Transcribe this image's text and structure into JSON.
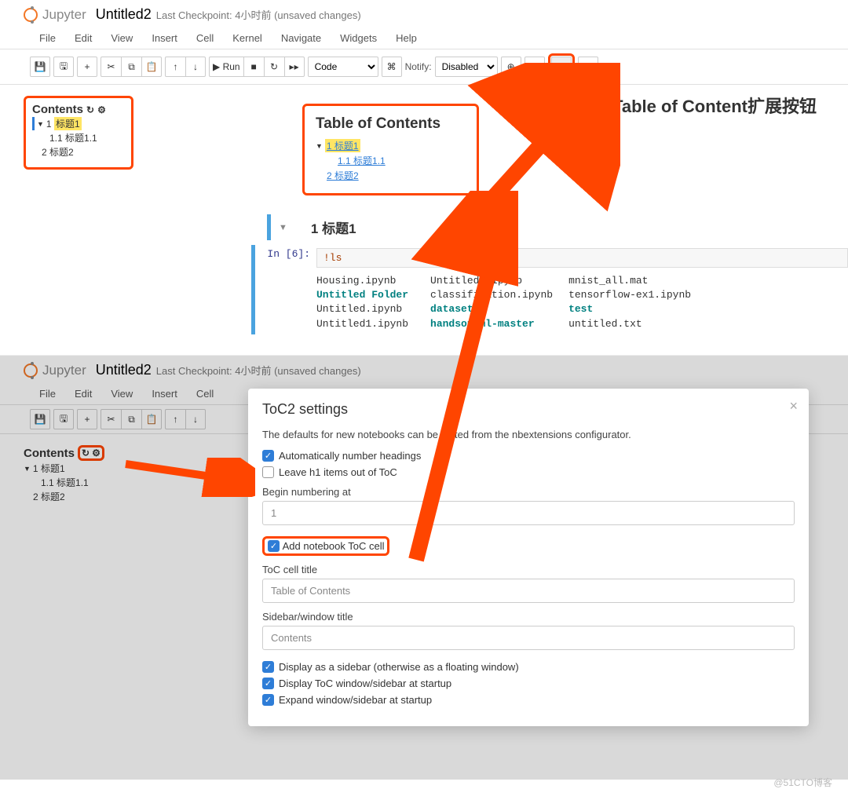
{
  "brand": "Jupyter",
  "title": "Untitled2",
  "checkpoint": "Last Checkpoint: 4小时前  (unsaved changes)",
  "menu": [
    "File",
    "Edit",
    "View",
    "Insert",
    "Cell",
    "Kernel",
    "Navigate",
    "Widgets",
    "Help"
  ],
  "toolbar": {
    "run": "▶ Run",
    "celltype": "Code",
    "notify_label": "Notify:",
    "notify_value": "Disabled"
  },
  "ext_label": "Table of Content扩展按钮",
  "sidebar": {
    "title": "Contents",
    "items": [
      {
        "n": "1",
        "label": "标题1",
        "level": 1,
        "active": true
      },
      {
        "n": "1.1",
        "label": "标题1.1",
        "level": 2
      },
      {
        "n": "2",
        "label": "标题2",
        "level": 1
      }
    ]
  },
  "toc_cell": {
    "title": "Table of Contents",
    "items": [
      {
        "label": "1  标题1",
        "level": 1,
        "active": true
      },
      {
        "label": "1.1  标题1.1",
        "level": 2
      },
      {
        "label": "2  标题2",
        "level": 1
      }
    ]
  },
  "heading": "1  标题1",
  "code": {
    "prompt": "In [6]:",
    "input": "!ls",
    "output_cols": [
      "Housing.ipynb\nUntitled Folder\nUntitled.ipynb\nUntitled1.ipynb",
      "Untitled2.ipynb\nclassification.ipynb\ndatasets\nhandson-ml-master",
      "mnist_all.mat\ntensorflow-ex1.ipynb\ntest\nuntitled.txt"
    ],
    "output_bold_rows": {
      "1": [
        1
      ],
      "2": [
        2,
        3
      ],
      "3": [
        2
      ]
    }
  },
  "modal": {
    "title": "ToC2 settings",
    "desc": "The defaults for new notebooks can be edited from the nbextensions configurator.",
    "opt_auto_number": "Automatically number headings",
    "opt_leave_h1": "Leave h1 items out of ToC",
    "label_begin": "Begin numbering at",
    "value_begin": "1",
    "opt_add_toc_cell": "Add notebook ToC cell",
    "label_toc_title": "ToC cell title",
    "value_toc_title": "Table of Contents",
    "label_sidebar_title": "Sidebar/window title",
    "value_sidebar_title": "Contents",
    "opt_display_sidebar": "Display as a sidebar (otherwise as a floating window)",
    "opt_display_startup": "Display ToC window/sidebar at startup",
    "opt_expand_startup": "Expand window/sidebar at startup"
  },
  "watermark": "@51CTO博客"
}
